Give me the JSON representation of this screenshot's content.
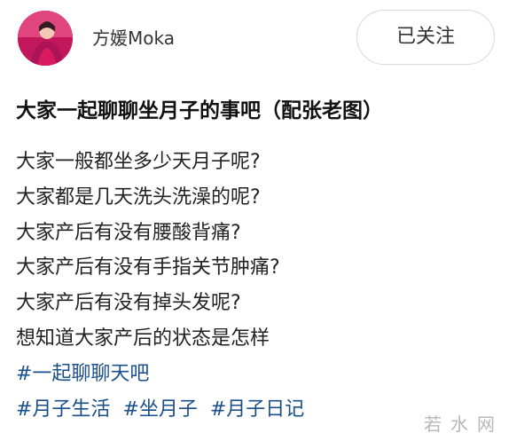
{
  "header": {
    "avatar_icon": "user-avatar-photo",
    "username": "方媛Moka",
    "follow_label": "已关注"
  },
  "post": {
    "title": "大家一起聊聊坐月子的事吧（配张老图）",
    "lines": [
      "大家一般都坐多少天月子呢?",
      "大家都是几天洗头洗澡的呢?",
      "大家产后有没有腰酸背痛?",
      "大家产后有没有手指关节肿痛?",
      "大家产后有没有掉头发呢?",
      "想知道大家产后的状态是怎样",
      "#一起聊聊天吧"
    ],
    "tags": [
      "#月子生活",
      "#坐月子",
      "#月子日记"
    ]
  },
  "watermark": "若水网",
  "colors": {
    "hashtag": "#1a4f8a",
    "avatar_bg": "#c2185b",
    "follow_border": "#d9d9d9"
  }
}
